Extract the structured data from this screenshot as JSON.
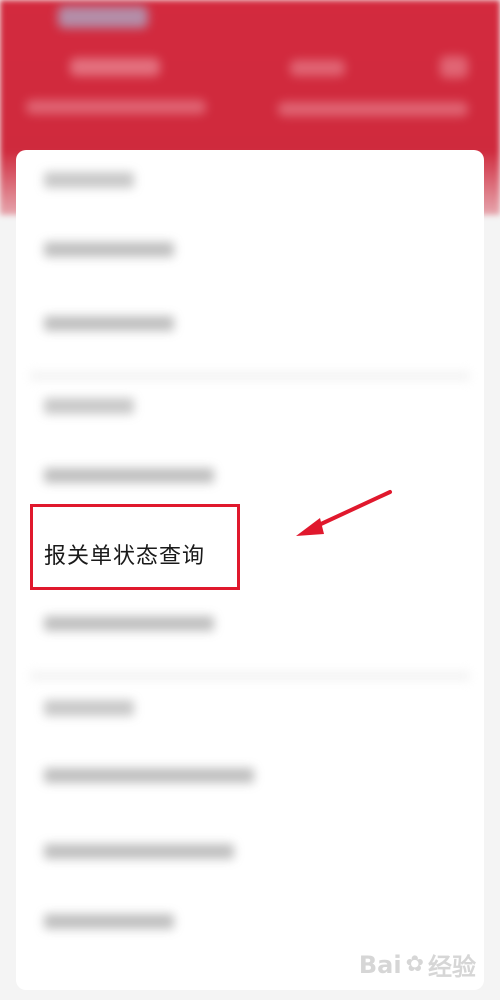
{
  "highlighted_item": {
    "label": "报关单状态查询"
  },
  "watermark": {
    "text_prefix": "Bai",
    "text_suffix": "经验"
  },
  "colors": {
    "header_red": "#d32a3e",
    "highlight_border": "#e0182d",
    "arrow_red": "#e0182d"
  }
}
